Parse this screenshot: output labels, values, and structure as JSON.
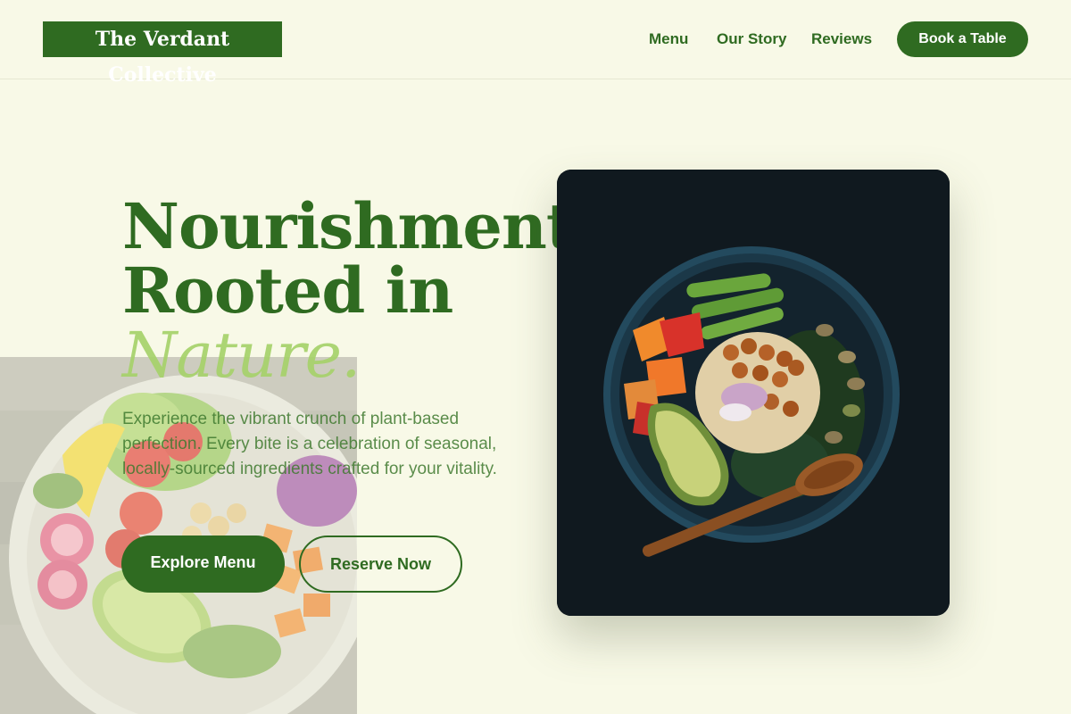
{
  "header": {
    "brand": "The Verdant Collective",
    "nav": [
      "Menu",
      "Our Story",
      "Reviews"
    ],
    "cta": "Book a Table"
  },
  "hero": {
    "headline_line1": "Nourishment",
    "headline_line2": "Rooted in",
    "headline_accent": "Nature.",
    "lede": "Experience the vibrant crunch of plant-based perfection. Every bite is a celebration of seasonal, locally-sourced ingredients crafted for your vitality.",
    "primary_button": "Explore Menu",
    "secondary_button": "Reserve Now"
  },
  "colors": {
    "brand_green": "#2f6b21",
    "accent_lime": "#a6d26b",
    "background": "#f8f9e7",
    "card_dark": "#111a20"
  }
}
